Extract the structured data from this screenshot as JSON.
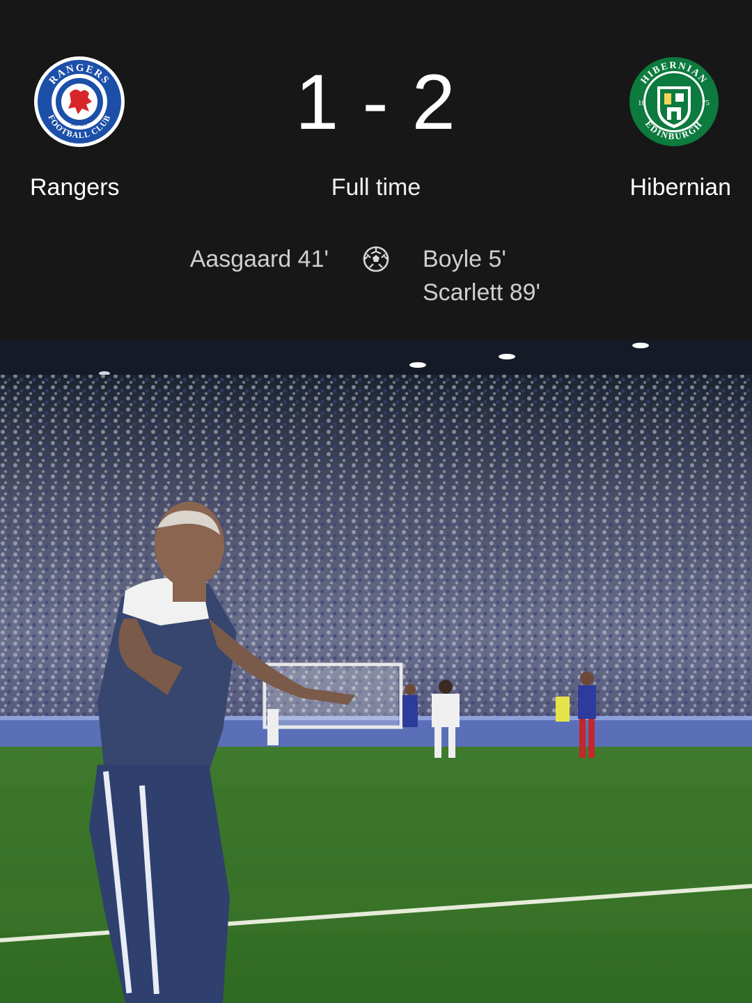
{
  "match": {
    "home_team": "Rangers",
    "away_team": "Hibernian",
    "home_score": "1",
    "separator": "-",
    "away_score": "2",
    "status": "Full time"
  },
  "crests": {
    "home": {
      "icon": "rangers-crest-icon",
      "ring_text_top": "RANGERS",
      "ring_text_bottom": "FOOTBALL CLUB",
      "motto": "READY",
      "color": "#1b4fa8"
    },
    "away": {
      "icon": "hibernian-crest-icon",
      "ring_text_top": "HIBERNIAN",
      "ring_text_bottom": "EDINBURGH",
      "year_left": "18",
      "year_right": "75",
      "color": "#0d7a3e"
    }
  },
  "goals": {
    "icon": "football-icon",
    "home": [
      "Aasgaard 41'"
    ],
    "away": [
      "Boyle 5'",
      "Scarlett 89'"
    ]
  },
  "photo": {
    "icon": "match-photo-image"
  }
}
